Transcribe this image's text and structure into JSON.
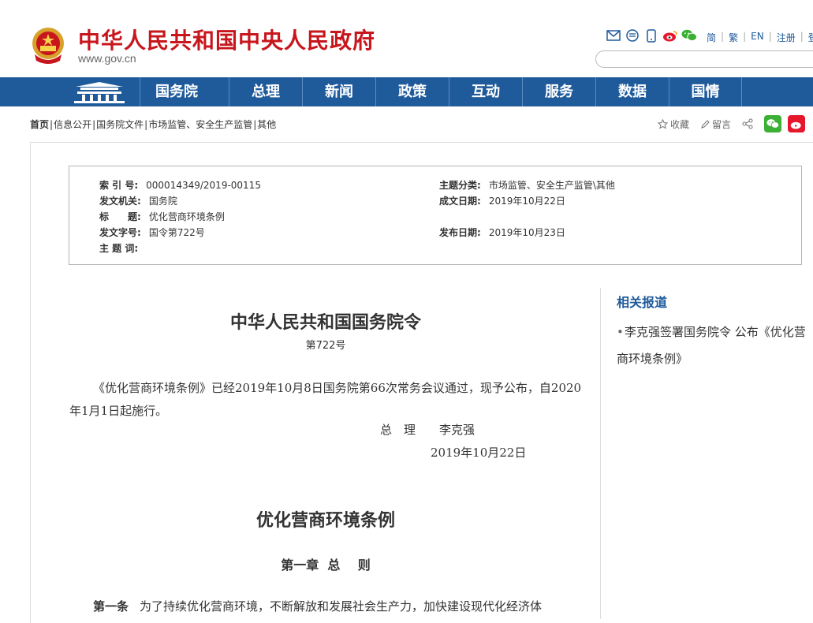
{
  "header": {
    "site_title": "中华人民共和国中央人民政府",
    "site_url": "www.gov.cn",
    "top_links": [
      "简",
      "繁",
      "EN",
      "注册",
      "登"
    ],
    "icons": [
      "mail-icon",
      "message-icon",
      "mobile-icon",
      "weibo-icon",
      "wechat-icon"
    ]
  },
  "nav": {
    "items": [
      "国务院",
      "总理",
      "新闻",
      "政策",
      "互动",
      "服务",
      "数据",
      "国情"
    ]
  },
  "breadcrumb": {
    "items": [
      "首页",
      "信息公开",
      "国务院文件",
      "市场监管、安全生产监管",
      "其他"
    ],
    "separator": "|"
  },
  "tools": {
    "favorite": "收藏",
    "comment": "留言"
  },
  "info": {
    "index_label": "索 引 号:",
    "index_value": "000014349/2019-00115",
    "issuer_label": "发文机关:",
    "issuer_value": "国务院",
    "title_label": "标　　题:",
    "title_value": "优化营商环境条例",
    "doc_no_label": "发文字号:",
    "doc_no_value": "国令第722号",
    "keywords_label": "主 题 词:",
    "keywords_value": "",
    "topic_label": "主题分类:",
    "topic_value": "市场监管、安全生产监管\\其他",
    "date_label": "成文日期:",
    "date_value": "2019年10月22日",
    "pub_label": "发布日期:",
    "pub_value": "2019年10月23日"
  },
  "article": {
    "title": "中华人民共和国国务院令",
    "number": "第722号",
    "paragraph": "《优化营商环境条例》已经2019年10月8日国务院第66次常务会议通过，现予公布，自2020年1月1日起施行。",
    "signature": "总　理　　李克强",
    "date": "2019年10月22日",
    "law_title": "优化营商环境条例",
    "chapter": "第一章  总    则",
    "article1_label": "第一条",
    "article1_text": "为了持续优化营商环境，不断解放和发展社会生产力，加快建设现代化经济体"
  },
  "sidebar": {
    "title": "相关报道",
    "items": [
      "李克强签署国务院令 公布《优化营商环境条例》"
    ]
  },
  "colors": {
    "brand_red": "#c8161d",
    "nav_blue": "#1f5a9b"
  }
}
